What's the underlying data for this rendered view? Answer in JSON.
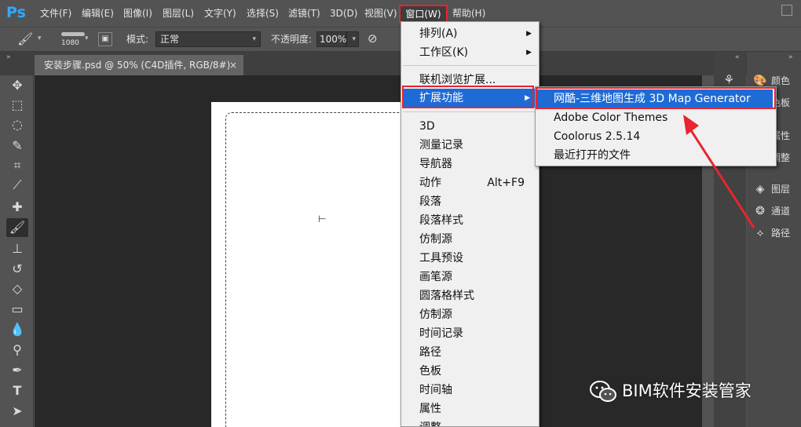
{
  "app": {
    "logo": "Ps"
  },
  "menubar": {
    "items": [
      "文件(F)",
      "编辑(E)",
      "图像(I)",
      "图层(L)",
      "文字(Y)",
      "选择(S)",
      "滤镜(T)",
      "3D(D)",
      "视图(V)",
      "窗口(W)",
      "帮助(H)"
    ]
  },
  "options": {
    "brush_size": "1080",
    "mode_label": "模式:",
    "mode_value": "正常",
    "opacity_label": "不透明度:",
    "opacity_value": "100%"
  },
  "document_tab": {
    "title": "安装步骤.psd @ 50% (C4D插件, RGB/8#)",
    "close": "×"
  },
  "window_menu": {
    "items": [
      {
        "label": "排列(A)",
        "submenu": true
      },
      {
        "label": "工作区(K)",
        "submenu": true
      },
      {
        "label": "联机浏览扩展..."
      },
      {
        "label": "扩展功能",
        "submenu": true,
        "highlighted": true
      },
      {
        "label": "3D"
      },
      {
        "label": "测量记录"
      },
      {
        "label": "导航器"
      },
      {
        "label": "动作",
        "shortcut": "Alt+F9"
      },
      {
        "label": "段落"
      },
      {
        "label": "段落样式"
      },
      {
        "label": "仿制源"
      },
      {
        "label": "工具预设"
      },
      {
        "label": "画笔源"
      },
      {
        "label": "圆落格样式"
      },
      {
        "label": "仿制源"
      },
      {
        "label": "时间记录"
      },
      {
        "label": "路径"
      },
      {
        "label": "色板"
      },
      {
        "label": "时间轴"
      },
      {
        "label": "属性"
      },
      {
        "label": "调整"
      }
    ]
  },
  "extensions_submenu": {
    "items": [
      {
        "label": "网酷-三维地图生成 3D Map Generator",
        "highlighted": true
      },
      {
        "label": "Adobe Color Themes"
      },
      {
        "label": "Coolorus 2.5.14"
      },
      {
        "label": "最近打开的文件"
      }
    ]
  },
  "panels": {
    "items": [
      "颜色",
      "色板",
      "属性",
      "调整",
      "图层",
      "通道",
      "路径"
    ]
  },
  "watermark": {
    "text": "BIM软件安装管家"
  },
  "colors": {
    "accent": "#1e6bd6",
    "highlight_border": "#e8242e",
    "ps_blue": "#31a8ff"
  }
}
